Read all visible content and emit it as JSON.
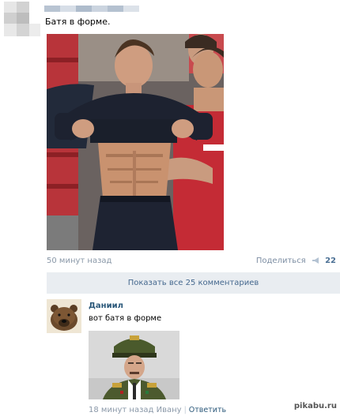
{
  "post": {
    "text": "Батя в форме.",
    "time": "50 минут назад",
    "share_label": "Поделиться",
    "share_count": "22"
  },
  "comments_bar": {
    "label": "Показать все 25 комментариев"
  },
  "comment": {
    "author": "Даниил",
    "text": "вот батя в форме",
    "time": "18 минут назад Ивану",
    "reply_label": "Ответить"
  },
  "watermark": {
    "text": "pikabu.ru"
  },
  "icons": {
    "share": "megaphone-icon"
  },
  "colors": {
    "link": "#2b587a",
    "meta": "#8a98a8",
    "bar_bg": "#e9edf1",
    "bar_text": "#45688e"
  }
}
